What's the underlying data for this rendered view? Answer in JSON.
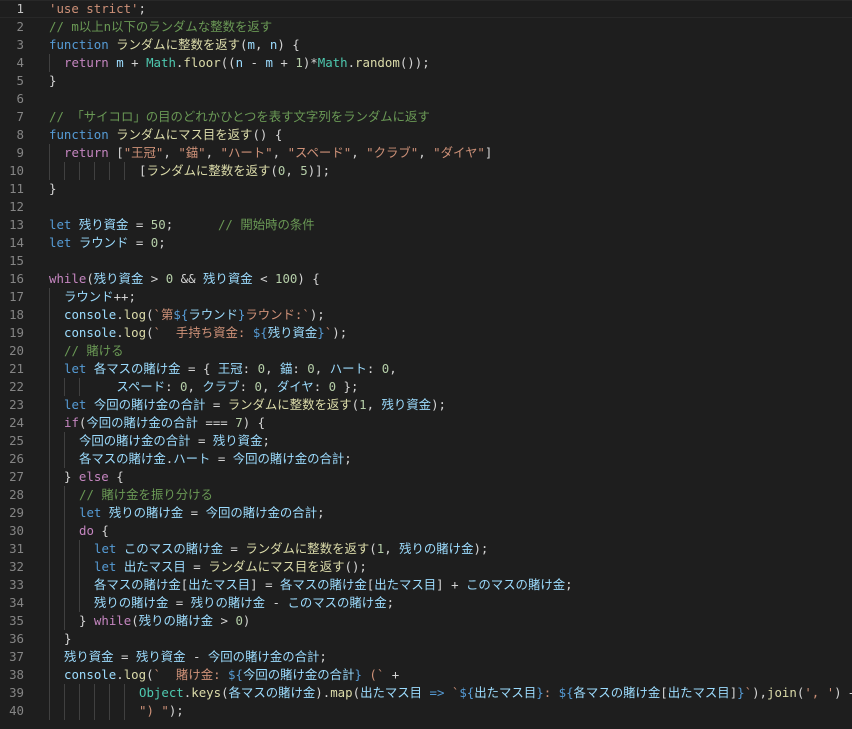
{
  "editor": {
    "active_line": 1,
    "colors": {
      "background": "#1e1e1e",
      "line_number": "#858585",
      "string": "#ce9178",
      "comment": "#6a9955",
      "keyword": "#569cd6",
      "control": "#c586c0",
      "function": "#dcdcaa",
      "variable": "#9cdcfe",
      "class": "#4ec9b0",
      "number": "#b5cea8"
    },
    "lines": [
      {
        "n": "1",
        "indent": 0,
        "tokens": [
          [
            "string",
            "'use strict'"
          ],
          [
            "punct",
            ";"
          ]
        ]
      },
      {
        "n": "2",
        "indent": 0,
        "tokens": [
          [
            "comment",
            "// m以上n以下のランダムな整数を返す"
          ]
        ]
      },
      {
        "n": "3",
        "indent": 0,
        "tokens": [
          [
            "keyword",
            "function "
          ],
          [
            "func",
            "ランダムに整数を返す"
          ],
          [
            "punct",
            "("
          ],
          [
            "var",
            "m"
          ],
          [
            "punct",
            ", "
          ],
          [
            "var",
            "n"
          ],
          [
            "punct",
            ") {"
          ]
        ]
      },
      {
        "n": "4",
        "indent": 1,
        "tokens": [
          [
            "control",
            "return "
          ],
          [
            "var",
            "m"
          ],
          [
            "punct",
            " + "
          ],
          [
            "class",
            "Math"
          ],
          [
            "punct",
            "."
          ],
          [
            "func",
            "floor"
          ],
          [
            "punct",
            "(("
          ],
          [
            "var",
            "n"
          ],
          [
            "punct",
            " - "
          ],
          [
            "var",
            "m"
          ],
          [
            "punct",
            " + "
          ],
          [
            "number",
            "1"
          ],
          [
            "punct",
            ")*"
          ],
          [
            "class",
            "Math"
          ],
          [
            "punct",
            "."
          ],
          [
            "func",
            "random"
          ],
          [
            "punct",
            "());"
          ]
        ]
      },
      {
        "n": "5",
        "indent": 0,
        "tokens": [
          [
            "punct",
            "}"
          ]
        ]
      },
      {
        "n": "6",
        "indent": 0,
        "tokens": []
      },
      {
        "n": "7",
        "indent": 0,
        "tokens": [
          [
            "comment",
            "// 「サイコロ」の目のどれかひとつを表す文字列をランダムに返す"
          ]
        ]
      },
      {
        "n": "8",
        "indent": 0,
        "tokens": [
          [
            "keyword",
            "function "
          ],
          [
            "func",
            "ランダムにマス目を返す"
          ],
          [
            "punct",
            "() {"
          ]
        ]
      },
      {
        "n": "9",
        "indent": 1,
        "tokens": [
          [
            "control",
            "return "
          ],
          [
            "punct",
            "["
          ],
          [
            "string",
            "\"王冠\""
          ],
          [
            "punct",
            ", "
          ],
          [
            "string",
            "\"錨\""
          ],
          [
            "punct",
            ", "
          ],
          [
            "string",
            "\"ハート\""
          ],
          [
            "punct",
            ", "
          ],
          [
            "string",
            "\"スペード\""
          ],
          [
            "punct",
            ", "
          ],
          [
            "string",
            "\"クラブ\""
          ],
          [
            "punct",
            ", "
          ],
          [
            "string",
            "\"ダイヤ\""
          ],
          [
            "punct",
            "]"
          ]
        ]
      },
      {
        "n": "10",
        "indent": 6,
        "tokens": [
          [
            "punct",
            "["
          ],
          [
            "func",
            "ランダムに整数を返す"
          ],
          [
            "punct",
            "("
          ],
          [
            "number",
            "0"
          ],
          [
            "punct",
            ", "
          ],
          [
            "number",
            "5"
          ],
          [
            "punct",
            ")];"
          ]
        ]
      },
      {
        "n": "11",
        "indent": 0,
        "tokens": [
          [
            "punct",
            "}"
          ]
        ]
      },
      {
        "n": "12",
        "indent": 0,
        "tokens": []
      },
      {
        "n": "13",
        "indent": 0,
        "tokens": [
          [
            "keyword",
            "let "
          ],
          [
            "var",
            "残り資金"
          ],
          [
            "punct",
            " = "
          ],
          [
            "number",
            "50"
          ],
          [
            "punct",
            ";      "
          ],
          [
            "comment",
            "// 開始時の条件"
          ]
        ]
      },
      {
        "n": "14",
        "indent": 0,
        "tokens": [
          [
            "keyword",
            "let "
          ],
          [
            "var",
            "ラウンド"
          ],
          [
            "punct",
            " = "
          ],
          [
            "number",
            "0"
          ],
          [
            "punct",
            ";"
          ]
        ]
      },
      {
        "n": "15",
        "indent": 0,
        "tokens": []
      },
      {
        "n": "16",
        "indent": 0,
        "tokens": [
          [
            "control",
            "while"
          ],
          [
            "punct",
            "("
          ],
          [
            "var",
            "残り資金"
          ],
          [
            "punct",
            " > "
          ],
          [
            "number",
            "0"
          ],
          [
            "punct",
            " && "
          ],
          [
            "var",
            "残り資金"
          ],
          [
            "punct",
            " < "
          ],
          [
            "number",
            "100"
          ],
          [
            "punct",
            ") {"
          ]
        ]
      },
      {
        "n": "17",
        "indent": 1,
        "tokens": [
          [
            "var",
            "ラウンド"
          ],
          [
            "punct",
            "++;"
          ]
        ]
      },
      {
        "n": "18",
        "indent": 1,
        "tokens": [
          [
            "var",
            "console"
          ],
          [
            "punct",
            "."
          ],
          [
            "func",
            "log"
          ],
          [
            "punct",
            "("
          ],
          [
            "string",
            "`第"
          ],
          [
            "interp",
            "${"
          ],
          [
            "var",
            "ラウンド"
          ],
          [
            "interp",
            "}"
          ],
          [
            "string",
            "ラウンド:`"
          ],
          [
            "punct",
            ");"
          ]
        ]
      },
      {
        "n": "19",
        "indent": 1,
        "tokens": [
          [
            "var",
            "console"
          ],
          [
            "punct",
            "."
          ],
          [
            "func",
            "log"
          ],
          [
            "punct",
            "("
          ],
          [
            "string",
            "`  手持ち資金: "
          ],
          [
            "interp",
            "${"
          ],
          [
            "var",
            "残り資金"
          ],
          [
            "interp",
            "}"
          ],
          [
            "string",
            "`"
          ],
          [
            "punct",
            ");"
          ]
        ]
      },
      {
        "n": "20",
        "indent": 1,
        "tokens": [
          [
            "comment",
            "// 賭ける"
          ]
        ]
      },
      {
        "n": "21",
        "indent": 1,
        "tokens": [
          [
            "keyword",
            "let "
          ],
          [
            "var",
            "各マスの賭け金"
          ],
          [
            "punct",
            " = { "
          ],
          [
            "var",
            "王冠"
          ],
          [
            "punct",
            ": "
          ],
          [
            "number",
            "0"
          ],
          [
            "punct",
            ", "
          ],
          [
            "var",
            "錨"
          ],
          [
            "punct",
            ": "
          ],
          [
            "number",
            "0"
          ],
          [
            "punct",
            ", "
          ],
          [
            "var",
            "ハート"
          ],
          [
            "punct",
            ": "
          ],
          [
            "number",
            "0"
          ],
          [
            "punct",
            ","
          ]
        ]
      },
      {
        "n": "22",
        "indent": 3,
        "tokens": [
          [
            "punct",
            "   "
          ],
          [
            "var",
            "スペード"
          ],
          [
            "punct",
            ": "
          ],
          [
            "number",
            "0"
          ],
          [
            "punct",
            ", "
          ],
          [
            "var",
            "クラブ"
          ],
          [
            "punct",
            ": "
          ],
          [
            "number",
            "0"
          ],
          [
            "punct",
            ", "
          ],
          [
            "var",
            "ダイヤ"
          ],
          [
            "punct",
            ": "
          ],
          [
            "number",
            "0"
          ],
          [
            "punct",
            " };"
          ]
        ]
      },
      {
        "n": "23",
        "indent": 1,
        "tokens": [
          [
            "keyword",
            "let "
          ],
          [
            "var",
            "今回の賭け金の合計"
          ],
          [
            "punct",
            " = "
          ],
          [
            "func",
            "ランダムに整数を返す"
          ],
          [
            "punct",
            "("
          ],
          [
            "number",
            "1"
          ],
          [
            "punct",
            ", "
          ],
          [
            "var",
            "残り資金"
          ],
          [
            "punct",
            ");"
          ]
        ]
      },
      {
        "n": "24",
        "indent": 1,
        "tokens": [
          [
            "control",
            "if"
          ],
          [
            "punct",
            "("
          ],
          [
            "var",
            "今回の賭け金の合計"
          ],
          [
            "punct",
            " === "
          ],
          [
            "number",
            "7"
          ],
          [
            "punct",
            ") {"
          ]
        ]
      },
      {
        "n": "25",
        "indent": 2,
        "tokens": [
          [
            "var",
            "今回の賭け金の合計"
          ],
          [
            "punct",
            " = "
          ],
          [
            "var",
            "残り資金"
          ],
          [
            "punct",
            ";"
          ]
        ]
      },
      {
        "n": "26",
        "indent": 2,
        "tokens": [
          [
            "var",
            "各マスの賭け金"
          ],
          [
            "punct",
            "."
          ],
          [
            "var",
            "ハート"
          ],
          [
            "punct",
            " = "
          ],
          [
            "var",
            "今回の賭け金の合計"
          ],
          [
            "punct",
            ";"
          ]
        ]
      },
      {
        "n": "27",
        "indent": 1,
        "tokens": [
          [
            "punct",
            "} "
          ],
          [
            "control",
            "else"
          ],
          [
            "punct",
            " {"
          ]
        ]
      },
      {
        "n": "28",
        "indent": 2,
        "tokens": [
          [
            "comment",
            "// 賭け金を振り分ける"
          ]
        ]
      },
      {
        "n": "29",
        "indent": 2,
        "tokens": [
          [
            "keyword",
            "let "
          ],
          [
            "var",
            "残りの賭け金"
          ],
          [
            "punct",
            " = "
          ],
          [
            "var",
            "今回の賭け金の合計"
          ],
          [
            "punct",
            ";"
          ]
        ]
      },
      {
        "n": "30",
        "indent": 2,
        "tokens": [
          [
            "control",
            "do"
          ],
          [
            "punct",
            " {"
          ]
        ]
      },
      {
        "n": "31",
        "indent": 3,
        "tokens": [
          [
            "keyword",
            "let "
          ],
          [
            "var",
            "このマスの賭け金"
          ],
          [
            "punct",
            " = "
          ],
          [
            "func",
            "ランダムに整数を返す"
          ],
          [
            "punct",
            "("
          ],
          [
            "number",
            "1"
          ],
          [
            "punct",
            ", "
          ],
          [
            "var",
            "残りの賭け金"
          ],
          [
            "punct",
            ");"
          ]
        ]
      },
      {
        "n": "32",
        "indent": 3,
        "tokens": [
          [
            "keyword",
            "let "
          ],
          [
            "var",
            "出たマス目"
          ],
          [
            "punct",
            " = "
          ],
          [
            "func",
            "ランダムにマス目を返す"
          ],
          [
            "punct",
            "();"
          ]
        ]
      },
      {
        "n": "33",
        "indent": 3,
        "tokens": [
          [
            "var",
            "各マスの賭け金"
          ],
          [
            "punct",
            "["
          ],
          [
            "var",
            "出たマス目"
          ],
          [
            "punct",
            "] = "
          ],
          [
            "var",
            "各マスの賭け金"
          ],
          [
            "punct",
            "["
          ],
          [
            "var",
            "出たマス目"
          ],
          [
            "punct",
            "] + "
          ],
          [
            "var",
            "このマスの賭け金"
          ],
          [
            "punct",
            ";"
          ]
        ]
      },
      {
        "n": "34",
        "indent": 3,
        "tokens": [
          [
            "var",
            "残りの賭け金"
          ],
          [
            "punct",
            " = "
          ],
          [
            "var",
            "残りの賭け金"
          ],
          [
            "punct",
            " - "
          ],
          [
            "var",
            "このマスの賭け金"
          ],
          [
            "punct",
            ";"
          ]
        ]
      },
      {
        "n": "35",
        "indent": 2,
        "tokens": [
          [
            "punct",
            "} "
          ],
          [
            "control",
            "while"
          ],
          [
            "punct",
            "("
          ],
          [
            "var",
            "残りの賭け金"
          ],
          [
            "punct",
            " > "
          ],
          [
            "number",
            "0"
          ],
          [
            "punct",
            ")"
          ]
        ]
      },
      {
        "n": "36",
        "indent": 1,
        "tokens": [
          [
            "punct",
            "}"
          ]
        ]
      },
      {
        "n": "37",
        "indent": 1,
        "tokens": [
          [
            "var",
            "残り資金"
          ],
          [
            "punct",
            " = "
          ],
          [
            "var",
            "残り資金"
          ],
          [
            "punct",
            " - "
          ],
          [
            "var",
            "今回の賭け金の合計"
          ],
          [
            "punct",
            ";"
          ]
        ]
      },
      {
        "n": "38",
        "indent": 1,
        "tokens": [
          [
            "var",
            "console"
          ],
          [
            "punct",
            "."
          ],
          [
            "func",
            "log"
          ],
          [
            "punct",
            "("
          ],
          [
            "string",
            "`  賭け金: "
          ],
          [
            "interp",
            "${"
          ],
          [
            "var",
            "今回の賭け金の合計"
          ],
          [
            "interp",
            "}"
          ],
          [
            "string",
            " ("
          ],
          [
            "string",
            "` "
          ],
          [
            "punct",
            "+"
          ]
        ]
      },
      {
        "n": "39",
        "indent": 6,
        "tokens": [
          [
            "class",
            "Object"
          ],
          [
            "punct",
            "."
          ],
          [
            "func",
            "keys"
          ],
          [
            "punct",
            "("
          ],
          [
            "var",
            "各マスの賭け金"
          ],
          [
            "punct",
            ")."
          ],
          [
            "func",
            "map"
          ],
          [
            "punct",
            "("
          ],
          [
            "var",
            "出たマス目"
          ],
          [
            "punct",
            " "
          ],
          [
            "keyword",
            "=>"
          ],
          [
            "punct",
            " "
          ],
          [
            "string",
            "`"
          ],
          [
            "interp",
            "${"
          ],
          [
            "var",
            "出たマス目"
          ],
          [
            "interp",
            "}"
          ],
          [
            "string",
            ": "
          ],
          [
            "interp",
            "${"
          ],
          [
            "var",
            "各マスの賭け金"
          ],
          [
            "punct",
            "["
          ],
          [
            "var",
            "出たマス目"
          ],
          [
            "punct",
            "]"
          ],
          [
            "interp",
            "}"
          ],
          [
            "string",
            "`"
          ],
          [
            "punct",
            "),"
          ],
          [
            "func",
            "join"
          ],
          [
            "punct",
            "("
          ],
          [
            "string",
            "', '"
          ],
          [
            "punct",
            ") +"
          ]
        ]
      },
      {
        "n": "40",
        "indent": 6,
        "tokens": [
          [
            "string",
            "\") \""
          ],
          [
            "punct",
            ");"
          ]
        ]
      }
    ]
  }
}
